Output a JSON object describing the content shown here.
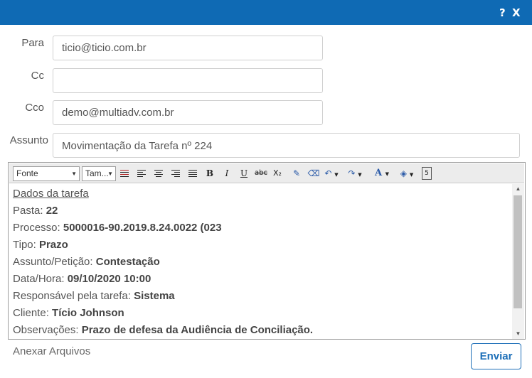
{
  "titlebar": {
    "help": "?",
    "close": "X"
  },
  "form": {
    "para": {
      "label": "Para",
      "value": "ticio@ticio.com.br"
    },
    "cc": {
      "label": "Cc",
      "value": ""
    },
    "cco": {
      "label": "Cco",
      "value": "demo@multiadv.com.br"
    },
    "assunto": {
      "label": "Assunto",
      "value": "Movimentação da Tarefa nº  224"
    }
  },
  "toolbar": {
    "font_select": "Fonte",
    "size_select": "Tam...",
    "bold": "B",
    "italic": "I",
    "underline": "U",
    "strikethrough": "abc",
    "subscript": "X₂",
    "font_color": "A"
  },
  "body": {
    "heading": "Dados da tarefa",
    "fields": [
      {
        "label": "Pasta: ",
        "value": "22"
      },
      {
        "label": "Processo: ",
        "value": "5000016-90.2019.8.24.0022 (023"
      },
      {
        "label": "Tipo: ",
        "value": "Prazo"
      },
      {
        "label": "Assunto/Petição: ",
        "value": "Contestação"
      },
      {
        "label": "Data/Hora: ",
        "value": "09/10/2020 10:00"
      },
      {
        "label": "Responsável pela tarefa: ",
        "value": "Sistema"
      },
      {
        "label": "Cliente: ",
        "value": "Tício Johnson"
      },
      {
        "label": "Observações: ",
        "value": "Prazo de defesa da Audiência de Conciliação."
      }
    ]
  },
  "footer": {
    "attach": "Anexar Arquivos",
    "send": "Enviar"
  }
}
